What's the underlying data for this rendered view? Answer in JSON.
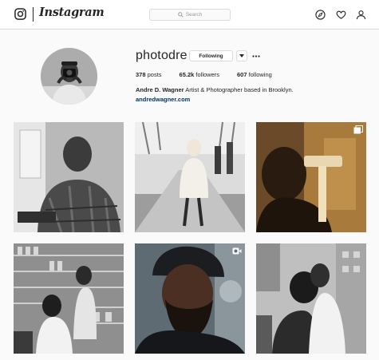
{
  "header": {
    "wordmark": "Instagram",
    "search_placeholder": "Search",
    "logo_icon": "instagram-camera-icon",
    "nav_icons": [
      "compass-icon",
      "heart-icon",
      "person-icon"
    ]
  },
  "profile": {
    "username": "photodre",
    "follow_label": "Following",
    "stats": {
      "posts_count": "378",
      "posts_label": "posts",
      "followers_count": "65.2k",
      "followers_label": "followers",
      "following_count": "607",
      "following_label": "following"
    },
    "bio_name": "Andre D. Wagner",
    "bio_text": "Artist & Photographer based in Brooklyn.",
    "website": "andredwagner.com"
  },
  "posts": [
    {
      "type": "photo"
    },
    {
      "type": "photo"
    },
    {
      "type": "carousel",
      "badge_icon": "carousel-icon"
    },
    {
      "type": "photo"
    },
    {
      "type": "video",
      "badge_icon": "video-icon"
    },
    {
      "type": "photo"
    }
  ],
  "colors": {
    "background": "#fafafa",
    "text": "#262626",
    "link": "#003569",
    "border": "#dbdbdb"
  }
}
